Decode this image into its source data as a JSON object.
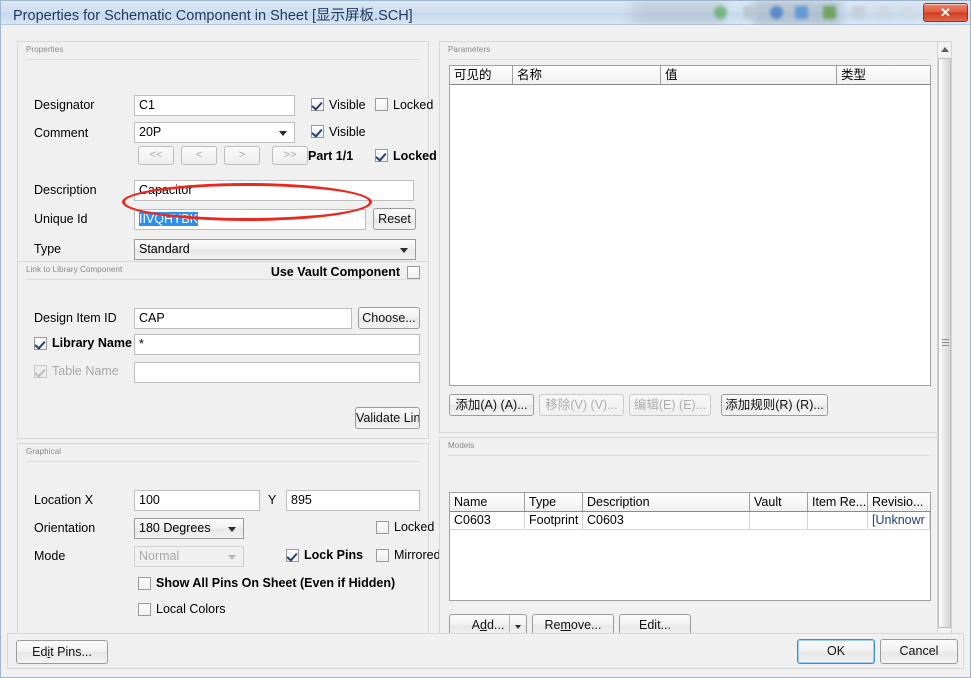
{
  "window": {
    "title": "Properties for Schematic Component in Sheet [显示屏板.SCH]",
    "close_label": "✕"
  },
  "properties": {
    "group_title": "Properties",
    "designator": {
      "label": "Designator",
      "value": "C1",
      "visible_label": "Visible",
      "visible_checked": true,
      "locked_label": "Locked",
      "locked_checked": false
    },
    "comment": {
      "label": "Comment",
      "value": "20P",
      "visible_label": "Visible",
      "visible_checked": true
    },
    "nav": {
      "first": "<<",
      "prev": "<",
      "next": ">",
      "last": ">>",
      "part_label": "Part 1/1",
      "locked_label": "Locked",
      "locked_checked": true
    },
    "description": {
      "label": "Description",
      "value": "Capacitor"
    },
    "unique_id": {
      "label": "Unique Id",
      "value": "IIVQHYBK",
      "selected": true,
      "reset_label": "Reset"
    },
    "type": {
      "label": "Type",
      "value": "Standard"
    }
  },
  "link_library": {
    "group_title": "Link to Library Component",
    "use_vault_label": "Use Vault Component",
    "use_vault_checked": false,
    "design_item_id": {
      "label": "Design Item ID",
      "value": "CAP",
      "choose_label": "Choose..."
    },
    "library_name": {
      "label": "Library Name",
      "value": "*",
      "checked": true,
      "disabled": false
    },
    "table_name": {
      "label": "Table Name",
      "value": "",
      "checked": true,
      "disabled": true
    },
    "validate_label": "Validate Link"
  },
  "graphical": {
    "group_title": "Graphical",
    "location": {
      "label": "Location  X",
      "x_value": "100",
      "y_label": "Y",
      "y_value": "895"
    },
    "orientation": {
      "label": "Orientation",
      "value": "180 Degrees"
    },
    "mode": {
      "label": "Mode",
      "value": "Normal",
      "disabled": true
    },
    "locked": {
      "label": "Locked",
      "checked": false
    },
    "lock_pins": {
      "label": "Lock Pins",
      "checked": true
    },
    "mirrored": {
      "label": "Mirrored",
      "checked": false
    },
    "show_all_pins": {
      "label": "Show All Pins On Sheet (Even if Hidden)",
      "checked": false
    },
    "local_colors": {
      "label": "Local Colors",
      "checked": false
    }
  },
  "parameters": {
    "group_title": "Parameters",
    "columns": [
      "可见的",
      "名称",
      "值",
      "类型"
    ],
    "sort_column_index": 1,
    "rows": [],
    "buttons": [
      {
        "label": "添加(A) (A)...",
        "disabled": false
      },
      {
        "label": "移除(V) (V)...",
        "disabled": true
      },
      {
        "label": "编辑(E) (E)...",
        "disabled": true
      },
      {
        "label": "添加规则(R) (R)...",
        "disabled": false
      }
    ]
  },
  "models": {
    "group_title": "Models",
    "columns": [
      "Name",
      "Type",
      "Description",
      "Vault",
      "Item Re...",
      "Revisio..."
    ],
    "sort_column_index": 1,
    "rows": [
      {
        "name": "C0603",
        "type": "Footprint",
        "description": "C0603",
        "vault": "",
        "item_rev": "",
        "revision": "[Unknowr"
      }
    ],
    "buttons": {
      "add": "Add...",
      "add_mnemonic": "d",
      "remove": "Remove...",
      "remove_mnemonic": "m",
      "edit": "Edit..."
    }
  },
  "footer": {
    "edit_pins_label": "Edit Pins...",
    "ok_label": "OK",
    "cancel_label": "Cancel"
  },
  "colors": {
    "accent": "#2a8fef",
    "annotation": "#e8291f",
    "close_button": "#cf3c20",
    "dialog_bg": "#f0f0f0"
  }
}
